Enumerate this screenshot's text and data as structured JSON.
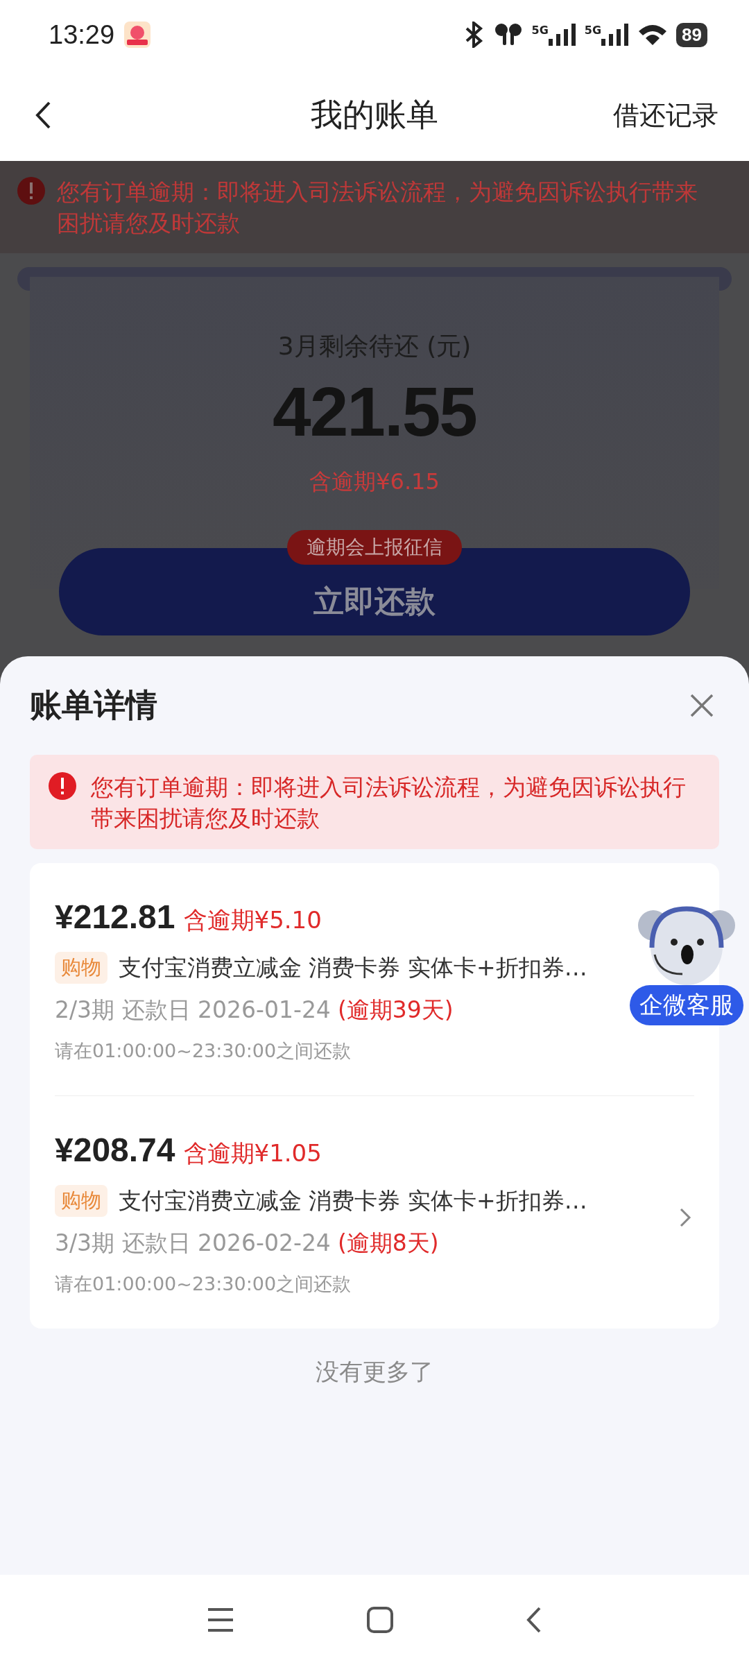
{
  "status_bar": {
    "time": "13:29",
    "networks": [
      {
        "label": "5G"
      },
      {
        "label": "5G"
      }
    ],
    "battery": "89"
  },
  "header": {
    "title": "我的账单",
    "action": "借还记录"
  },
  "notice": "您有订单逾期：即将进入司法诉讼流程，为避免因诉讼执行带来困扰请您及时还款",
  "summary": {
    "label": "3月剩余待还 (元)",
    "amount": "421.55",
    "overdue": "含逾期¥6.15",
    "badge": "逾期会上报征信",
    "button": "立即还款"
  },
  "sheet": {
    "title": "账单详情",
    "alert": "您有订单逾期：即将进入司法诉讼流程，为避免因诉讼执行带来困扰请您及时还款",
    "bills": [
      {
        "amount": "¥212.81",
        "overdue": "含逾期¥5.10",
        "tag": "购物",
        "description": "支付宝消费立减金 消费卡券 实体卡+折扣券…",
        "schedule": "2/3期 还款日 2026-01-24",
        "overdue_days": "(逾期39天)",
        "hint": "请在01:00:00~23:30:00之间还款",
        "chevron": false
      },
      {
        "amount": "¥208.74",
        "overdue": "含逾期¥1.05",
        "tag": "购物",
        "description": "支付宝消费立减金 消费卡券 实体卡+折扣券…",
        "schedule": "3/3期 还款日 2026-02-24",
        "overdue_days": "(逾期8天)",
        "hint": "请在01:00:00~23:30:00之间还款",
        "chevron": true
      }
    ],
    "footer": "没有更多了"
  },
  "service": {
    "label": "企微客服"
  }
}
